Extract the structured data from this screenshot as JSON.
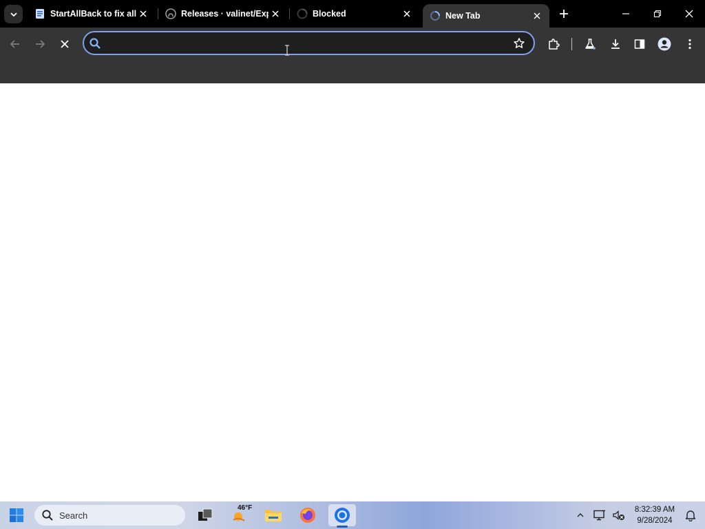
{
  "tabs": [
    {
      "title": "StartAllBack to fix all W",
      "favicon": "document-favicon",
      "active": false
    },
    {
      "title": "Releases · valinet/Expl",
      "favicon": "github-favicon",
      "active": false
    },
    {
      "title": "Blocked",
      "favicon": "spinner-favicon",
      "active": false
    },
    {
      "title": "New Tab",
      "favicon": "loading-favicon",
      "active": true
    }
  ],
  "omnibox": {
    "value": "",
    "placeholder": ""
  },
  "taskbar": {
    "search_label": "Search",
    "weather_temp": "46°F",
    "clock_time": "8:32:39 AM",
    "clock_date": "9/28/2024"
  },
  "colors": {
    "tabstrip": "#000000",
    "toolbar": "#353535",
    "omnibox_border": "#7fa3f2",
    "accent_blue": "#1a5fb4"
  }
}
